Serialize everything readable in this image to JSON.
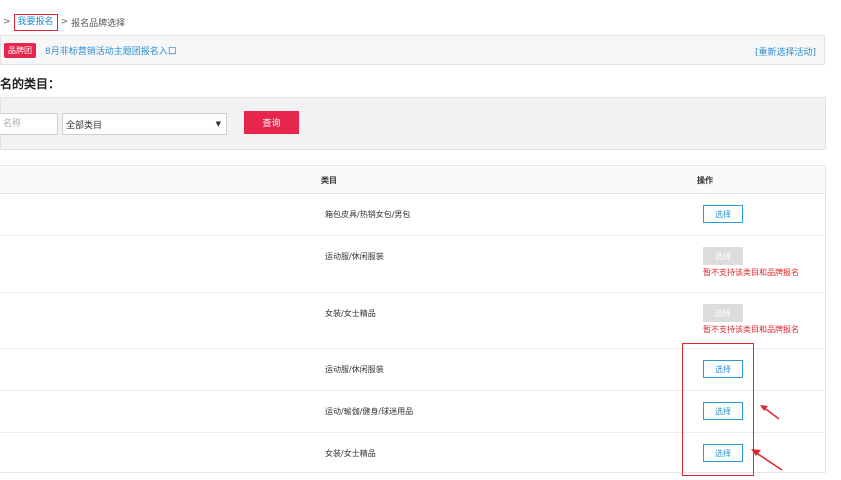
{
  "breadcrumb": {
    "sep1": ">",
    "link": "我要报名",
    "sep2": ">",
    "current": "报名品牌选择"
  },
  "activity": {
    "badge": "品牌团",
    "title": "8月非标营销活动主题团报名入口",
    "reselect": "[重新选择活动]"
  },
  "section_title": "名的类目：",
  "filter": {
    "name_placeholder": "名称",
    "category_value": "全部类目",
    "caret": "▼",
    "query_label": "查询"
  },
  "table": {
    "headers": {
      "category": "类目",
      "operation": "操作"
    },
    "rows": [
      {
        "category": "箱包皮具/热销女包/男包",
        "enabled": true,
        "button": "选择"
      },
      {
        "category": "运动服/休闲服装",
        "enabled": false,
        "button": "选择",
        "note": "暂不支持该类目和品牌报名"
      },
      {
        "category": "女装/女士精品",
        "enabled": false,
        "button": "选择",
        "note": "暂不支持该类目和品牌报名"
      },
      {
        "category": "运动服/休闲服装",
        "enabled": true,
        "button": "选择"
      },
      {
        "category": "运动/瑜伽/健身/球迷用品",
        "enabled": true,
        "button": "选择"
      },
      {
        "category": "女装/女士精品",
        "enabled": true,
        "button": "选择"
      }
    ]
  },
  "annotation_color": "#e0262e",
  "accent_color": "#e8264d",
  "link_color": "#2b8fd4"
}
